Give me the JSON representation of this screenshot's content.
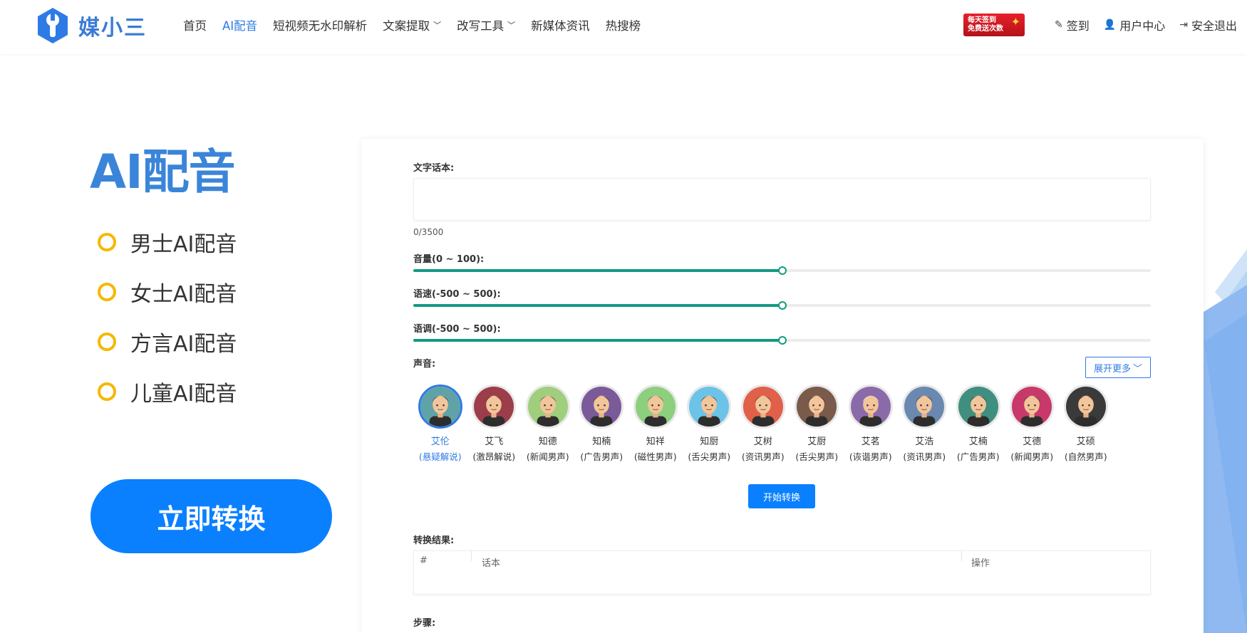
{
  "header": {
    "logo_text": "媒小三",
    "nav": [
      {
        "label": "首页",
        "active": false,
        "dropdown": false
      },
      {
        "label": "AI配音",
        "active": true,
        "dropdown": false
      },
      {
        "label": "短视频无水印解析",
        "active": false,
        "dropdown": false
      },
      {
        "label": "文案提取",
        "active": false,
        "dropdown": true
      },
      {
        "label": "改写工具",
        "active": false,
        "dropdown": true
      },
      {
        "label": "新媒体资讯",
        "active": false,
        "dropdown": false
      },
      {
        "label": "热搜榜",
        "active": false,
        "dropdown": false
      }
    ],
    "sign_badge": {
      "line1": "每天签到",
      "line2": "免费送次数"
    },
    "checkin": "签到",
    "user_center": "用户中心",
    "logout": "安全退出"
  },
  "left": {
    "title": "AI配音",
    "features": [
      "男士AI配音",
      "女士AI配音",
      "方言AI配音",
      "儿童AI配音"
    ],
    "convert_button": "立即转换"
  },
  "form": {
    "text_label": "文字话本:",
    "text_value": "",
    "counter": "0/3500",
    "volume": {
      "label": "音量(0 ~ 100):",
      "min": 0,
      "max": 100,
      "value": 50
    },
    "speed": {
      "label": "语速(-500 ~ 500):",
      "min": -500,
      "max": 500,
      "value": 0
    },
    "pitch": {
      "label": "语调(-500 ~ 500):",
      "min": -500,
      "max": 500,
      "value": 0
    },
    "voice_label": "声音:",
    "expand_label": "展开更多",
    "voices": [
      {
        "name": "艾伦",
        "desc": "(悬疑解说)",
        "selected": true,
        "bg": "#5fa3a8",
        "hair": "#3a2a20"
      },
      {
        "name": "艾飞",
        "desc": "(激昂解说)",
        "selected": false,
        "bg": "#9c3d4a",
        "hair": "#5a1e24"
      },
      {
        "name": "知德",
        "desc": "(新闻男声)",
        "selected": false,
        "bg": "#9fcf7d",
        "hair": "#2a2a2a"
      },
      {
        "name": "知楠",
        "desc": "(广告男声)",
        "selected": false,
        "bg": "#7b5a9a",
        "hair": "#3c2a1e"
      },
      {
        "name": "知祥",
        "desc": "(磁性男声)",
        "selected": false,
        "bg": "#8ccf7d",
        "hair": "#555555"
      },
      {
        "name": "知厨",
        "desc": "(舌尖男声)",
        "selected": false,
        "bg": "#6cc3e8",
        "hair": "#2a2a2a"
      },
      {
        "name": "艾树",
        "desc": "(资讯男声)",
        "selected": false,
        "bg": "#e0604a",
        "hair": "#3a2a20"
      },
      {
        "name": "艾厨",
        "desc": "(舌尖男声)",
        "selected": false,
        "bg": "#7a5a4a",
        "hair": "#222222"
      },
      {
        "name": "艾茗",
        "desc": "(诙谐男声)",
        "selected": false,
        "bg": "#8a6aa8",
        "hair": "#f0f0f0"
      },
      {
        "name": "艾浩",
        "desc": "(资讯男声)",
        "selected": false,
        "bg": "#6a88b0",
        "hair": "#222222"
      },
      {
        "name": "艾楠",
        "desc": "(广告男声)",
        "selected": false,
        "bg": "#3f8f80",
        "hair": "#1e1e1e"
      },
      {
        "name": "艾德",
        "desc": "(新闻男声)",
        "selected": false,
        "bg": "#c8386a",
        "hair": "#333333"
      },
      {
        "name": "艾硕",
        "desc": "(自然男声)",
        "selected": false,
        "bg": "#3a3a3a",
        "hair": "#7a1e1e"
      }
    ],
    "start_button": "开始转换",
    "result_label": "转换结果:",
    "result_columns": [
      "#",
      "话本",
      "操作"
    ],
    "steps_label": "步骤:"
  },
  "colors": {
    "accent": "#2f7be5",
    "button": "#0a80ff",
    "slider": "#139a83",
    "ring": "#f5b800"
  }
}
